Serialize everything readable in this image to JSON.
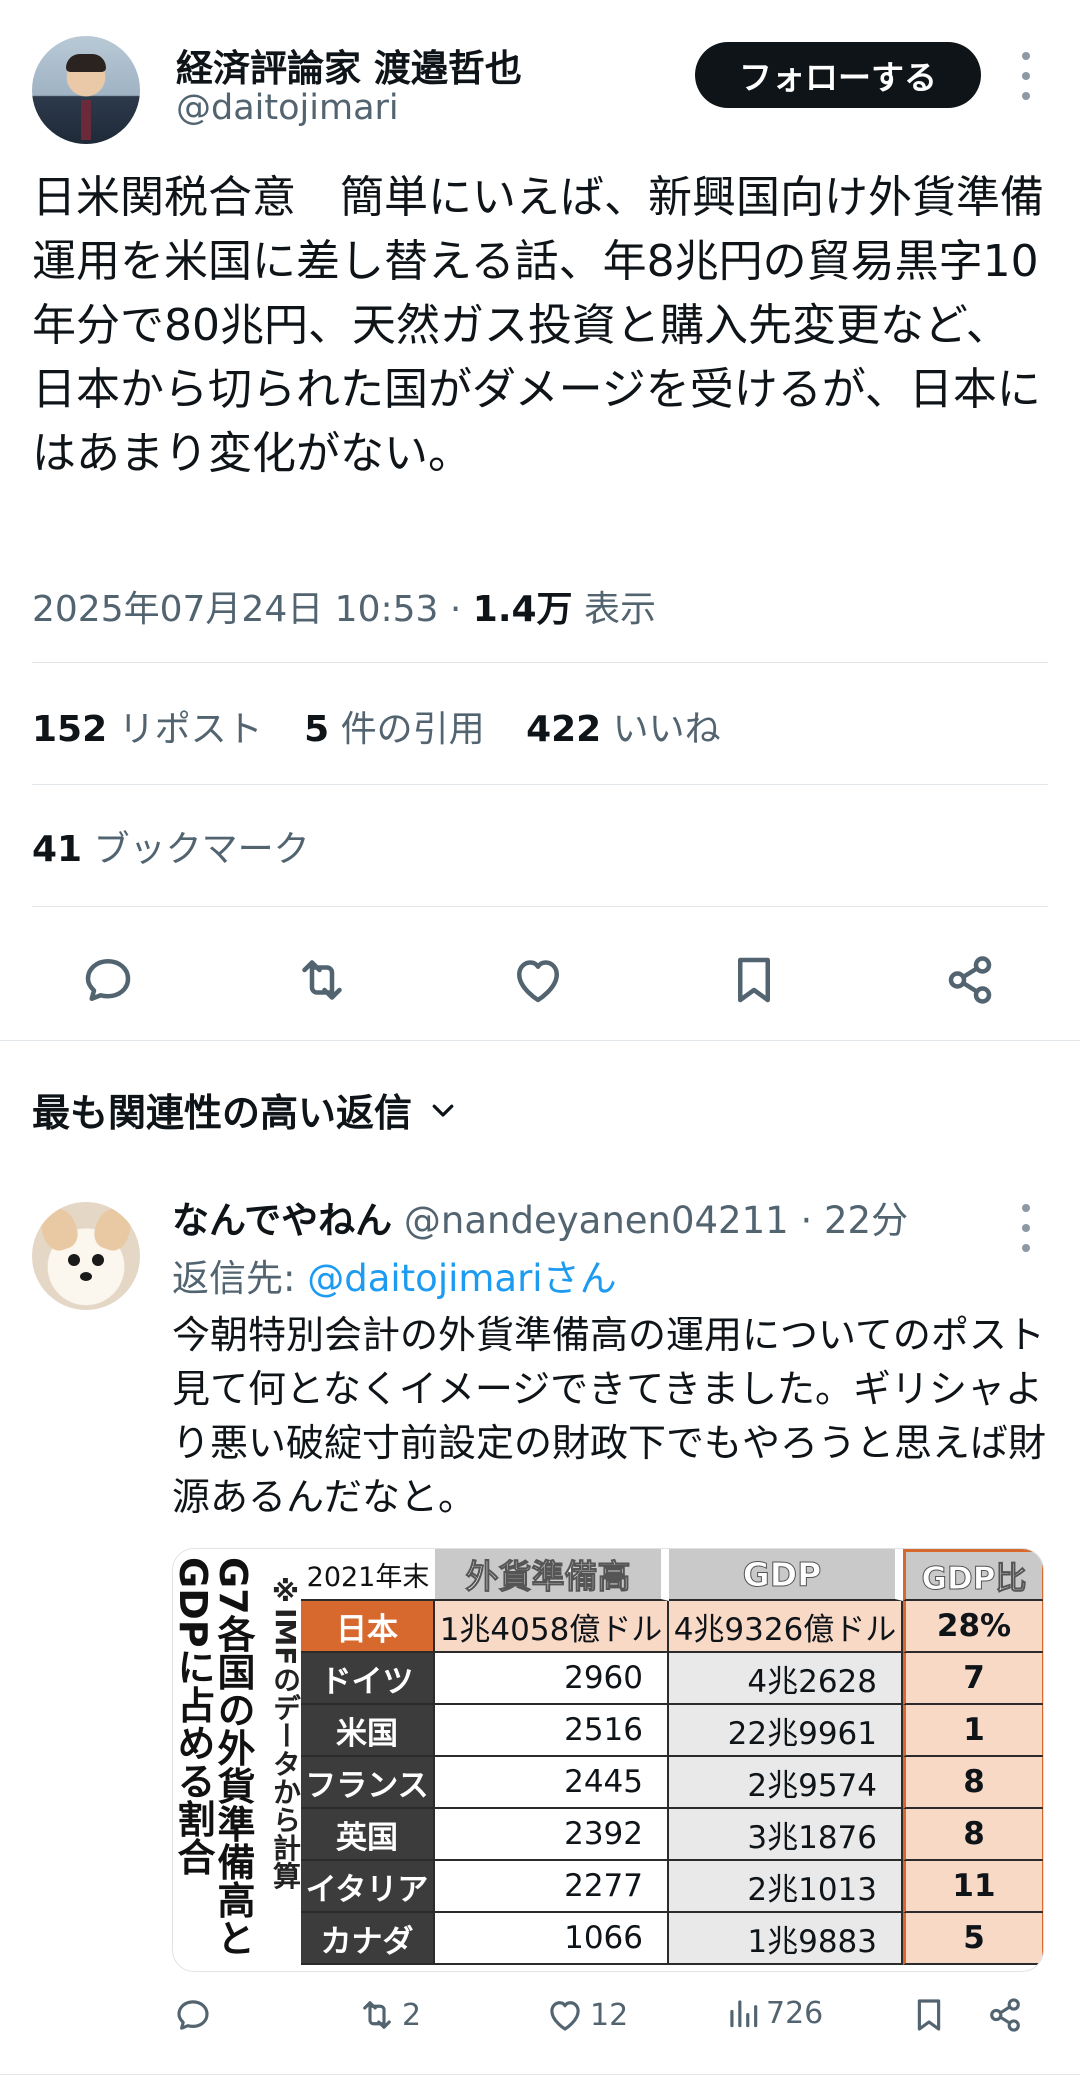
{
  "tweet": {
    "author_name": "経済評論家 渡邉哲也",
    "author_handle": "@daitojimari",
    "follow_label": "フォローする",
    "text": "日米関税合意　簡単にいえば、新興国向け外貨準備運用を米国に差し替える話、年8兆円の貿易黒字10年分で80兆円、天然ガス投資と購入先変更など、日本から切られた国がダメージを受けるが、日本にはあまり変化がない。",
    "timestamp": "2025年07月24日 10:53",
    "views_count": "1.4万",
    "views_label": "表示",
    "reposts_count": "152",
    "reposts_label": "リポスト",
    "quotes_count": "5",
    "quotes_label": "件の引用",
    "likes_count": "422",
    "likes_label": "いいね",
    "bookmarks_count": "41",
    "bookmarks_label": "ブックマーク"
  },
  "icons": [
    "reply-icon",
    "repost-icon",
    "like-icon",
    "bookmark-icon",
    "share-icon",
    "more-icon",
    "chevron-down-icon",
    "views-icon"
  ],
  "replies_heading": "最も関連性の高い返信",
  "reply": {
    "name": "なんでやねん",
    "handle": "@nandeyanen04211",
    "time": "22分",
    "reply_to_prefix": "返信先: ",
    "reply_to_mention": "@daitojimariさん",
    "text": "今朝特別会計の外貨準備高の運用についてのポスト見て何となくイメージできてきました。ギリシャより悪い破綻寸前設定の財政下でもやろうと思えば財源あるんだなと。",
    "image": {
      "title_line1": "G7各国の外貨準備高と",
      "title_line2": "GDPに占める割合",
      "note": "※IMFのデータから計算",
      "header": [
        "2021年末",
        "外貨準備高",
        "GDP",
        "GDP比"
      ],
      "rows": [
        [
          "日本",
          "1兆4058億ドル",
          "4兆9326億ドル",
          "28%"
        ],
        [
          "ドイツ",
          "2960",
          "4兆2628",
          "7"
        ],
        [
          "米国",
          "2516",
          "22兆9961",
          "1"
        ],
        [
          "フランス",
          "2445",
          "2兆9574",
          "8"
        ],
        [
          "英国",
          "2392",
          "3兆1876",
          "8"
        ],
        [
          "イタリア",
          "2277",
          "2兆1013",
          "11"
        ],
        [
          "カナダ",
          "1066",
          "1兆9883",
          "5"
        ]
      ]
    },
    "reposts": "2",
    "likes": "12",
    "views": "726"
  },
  "colors": {
    "text": "#0f1419",
    "secondary": "#536471",
    "link": "#1d9bf0",
    "divider": "#e1e6ea",
    "table_accent": "#d8692e",
    "table_highlight": "#f8d9c6"
  }
}
